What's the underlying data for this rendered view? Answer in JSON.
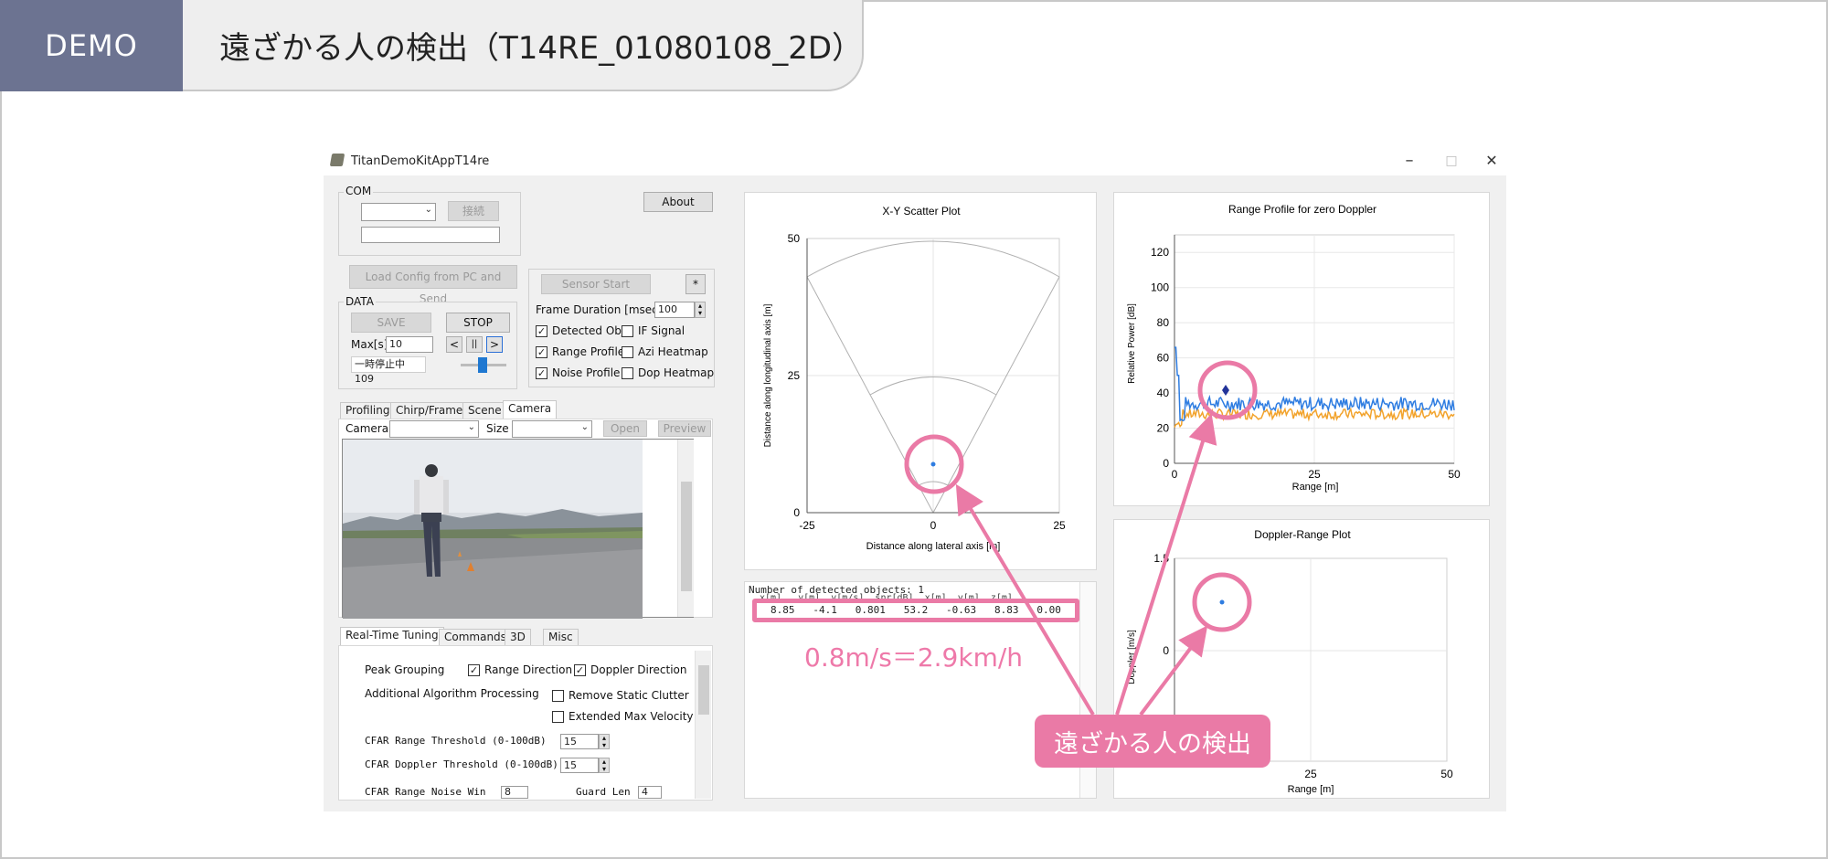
{
  "slide": {
    "tag": "DEMO",
    "title": "遠ざかる人の検出（T14RE_01080108_2D）",
    "callout": "遠ざかる人の検出",
    "speed_note": "0.8m/s＝2.9km/h",
    "accent_color": "#ea7aa6",
    "tag_color": "#6c7391"
  },
  "window": {
    "title": "TitanDemoKitAppT14re",
    "minimize": "–",
    "maximize": "□",
    "close": "✕"
  },
  "controls": {
    "com_group": "COM",
    "connect": "接続",
    "about": "About",
    "load_config": "Load Config from PC and Send",
    "sensor_start": "Sensor Start",
    "star": "*",
    "frame_duration_label": "Frame Duration [msec]",
    "frame_duration_value": "100",
    "data_group": "DATA",
    "save": "SAVE",
    "stop": "STOP",
    "max_label": "Max[s]",
    "max_value": "10",
    "prev": "<",
    "pause": "||",
    "next": ">",
    "status": "一時停止中 109",
    "checks": {
      "detected_obj": "Detected Obj",
      "if_signal": "IF Signal",
      "range_profile": "Range Profile",
      "azi_heatmap": "Azi Heatmap",
      "noise_profile": "Noise Profile",
      "dop_heatmap": "Dop Heatmap"
    }
  },
  "tabs": {
    "top": [
      "Profiling",
      "Chirp/Frame",
      "Scene",
      "Camera"
    ],
    "bottom": [
      "Real-Time Tuning",
      "Commands",
      "3D",
      "Misc"
    ]
  },
  "camera": {
    "camera_label": "Camera",
    "size_label": "Size",
    "open": "Open",
    "preview": "Preview"
  },
  "tuning": {
    "peak_grouping": "Peak Grouping",
    "range_direction": "Range Direction",
    "doppler_direction": "Doppler Direction",
    "additional": "Additional Algorithm Processing",
    "remove_static": "Remove Static Clutter",
    "extended_velocity": "Extended Max Velocity",
    "cfar_range": "CFAR Range Threshold (0-100dB)",
    "cfar_range_value": "15",
    "cfar_doppler": "CFAR Doppler Threshold (0-100dB)",
    "cfar_doppler_value": "15",
    "cfar_noise": "CFAR Range Noise Win",
    "cfar_noise_value": "8",
    "guard_len": "Guard Len",
    "guard_len_value": "4"
  },
  "detections": {
    "header": "Number of detected objects: 1",
    "columns": "x[m]   y[m]  v[m/s]  snr[dB]  x[m]  y[m]  z[m]",
    "row": "8.85   -4.1   0.801   53.2   -0.63   8.83   0.00"
  },
  "plots": {
    "scatter": {
      "title": "X-Y Scatter Plot",
      "xlabel": "Distance along lateral axis [m]",
      "ylabel": "Distance along longitudinal axis [m]",
      "xticks": [
        "-25",
        "0",
        "25"
      ],
      "yticks": [
        "50",
        "25",
        "0"
      ]
    },
    "range_profile": {
      "title": "Range Profile for zero Doppler",
      "xlabel": "Range [m]",
      "ylabel": "Relative Power [dB]",
      "xticks": [
        "0",
        "25",
        "50"
      ],
      "yticks": [
        "120",
        "100",
        "80",
        "60",
        "40",
        "20",
        "0"
      ]
    },
    "doppler": {
      "title": "Doppler-Range Plot",
      "xlabel": "Range [m]",
      "ylabel": "Doppler [m/s]",
      "xticks": [
        "25",
        "50"
      ],
      "yticks": [
        "1.5",
        "0"
      ]
    }
  }
}
